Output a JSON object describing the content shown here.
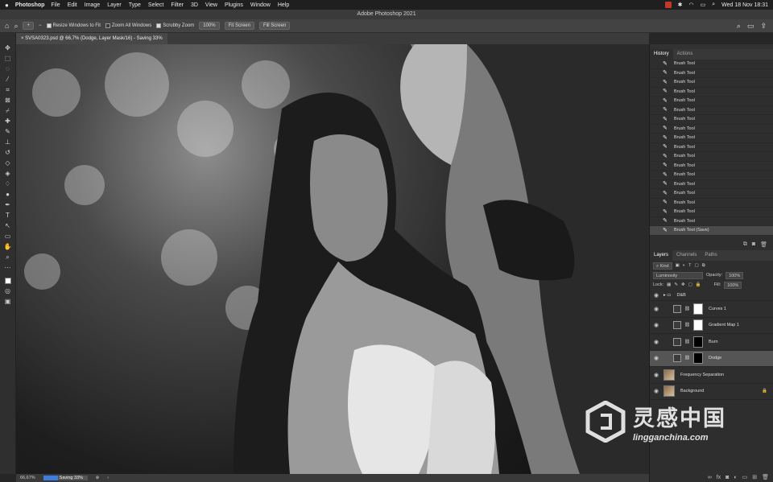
{
  "menubar": {
    "apple": "",
    "app_name": "Photoshop",
    "items": [
      "File",
      "Edit",
      "Image",
      "Layer",
      "Type",
      "Select",
      "Filter",
      "3D",
      "View",
      "Plugins",
      "Window",
      "Help"
    ],
    "clock": "Wed 18 Nov 18:31"
  },
  "window": {
    "title": "Adobe Photoshop 2021"
  },
  "options": {
    "resize_windows": "Resize Windows to Fit",
    "zoom_all": "Zoom All Windows",
    "scrubby_zoom": "Scrubby Zoom",
    "zoom_100": "100%",
    "fit_screen": "Fit Screen",
    "fill_screen": "Fill Screen",
    "resize_checked": true,
    "zoom_all_checked": false,
    "scrubby_checked": true
  },
  "document": {
    "tab_title": "SVSA0323.psd @ 66,7% (Dodge, Layer Mask/16) - Saving 33%"
  },
  "status": {
    "zoom": "66,67%",
    "saving": "Saving 33%",
    "progress": 0.33
  },
  "history": {
    "tabs": [
      "History",
      "Actions"
    ],
    "items": [
      "Brush Tool",
      "Brush Tool",
      "Brush Tool",
      "Brush Tool",
      "Brush Tool",
      "Brush Tool",
      "Brush Tool",
      "Brush Tool",
      "Brush Tool",
      "Brush Tool",
      "Brush Tool",
      "Brush Tool",
      "Brush Tool",
      "Brush Tool",
      "Brush Tool",
      "Brush Tool",
      "Brush Tool",
      "Brush Tool",
      "Brush Tool (Save)"
    ]
  },
  "layers": {
    "tabs": [
      "Layers",
      "Channels",
      "Paths"
    ],
    "filter": "Kind",
    "blend_mode": "Luminosity",
    "opacity_label": "Opacity:",
    "opacity": "100%",
    "lock_label": "Lock:",
    "fill_label": "Fill:",
    "fill": "100%",
    "items": [
      {
        "name": "D&B",
        "kind": "group"
      },
      {
        "name": "Curves 1",
        "kind": "adjustment",
        "mask": "white"
      },
      {
        "name": "Gradient Map 1",
        "kind": "adjustment",
        "mask": "white"
      },
      {
        "name": "Burn",
        "kind": "adjustment",
        "mask": "black"
      },
      {
        "name": "Dodge",
        "kind": "adjustment",
        "mask": "black",
        "active": true
      },
      {
        "name": "Frequency Separation",
        "kind": "image"
      },
      {
        "name": "Background",
        "kind": "image",
        "locked": true
      }
    ]
  },
  "watermark": {
    "cn": "灵感中国",
    "en": "lingganchina.com"
  },
  "colors": {
    "progress": "#3b7de0",
    "panel_bg": "#2e2e2e",
    "active_row": "#555555"
  }
}
